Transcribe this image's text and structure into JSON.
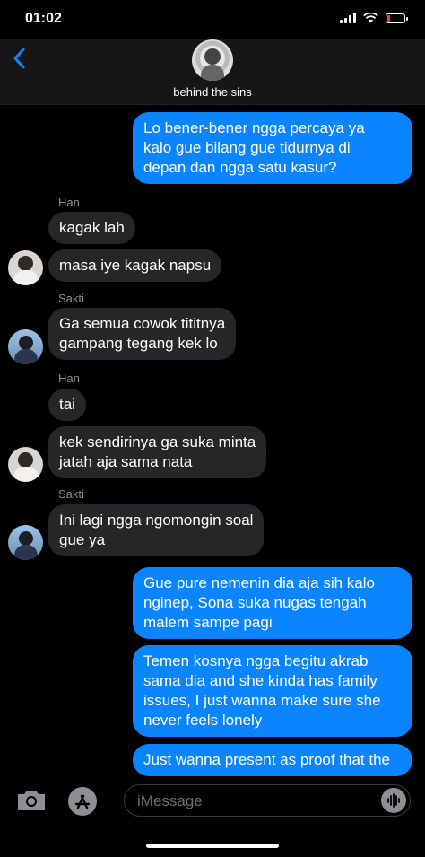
{
  "status": {
    "time": "01:02"
  },
  "header": {
    "contact_name": "behind the sins"
  },
  "messages": [
    {
      "text": "Lo bener-bener ngga percaya ya\nkalo gue bilang gue tidurnya di\ndepan dan ngga satu kasur?"
    },
    {
      "sender": "Han",
      "text": "kagak lah"
    },
    {
      "text": "masa iye kagak napsu"
    },
    {
      "sender": "Sakti",
      "text": "Ga semua cowok tititnya\ngampang tegang kek lo"
    },
    {
      "sender": "Han",
      "text": "tai"
    },
    {
      "text": "kek sendirinya ga suka minta\njatah aja sama nata"
    },
    {
      "sender": "Sakti",
      "text": "Ini lagi ngga ngomongin soal\ngue ya"
    },
    {
      "text": "Gue pure nemenin dia aja sih kalo\nnginep, Sona suka nugas tengah\nmalem sampe pagi"
    },
    {
      "text": "Temen kosnya ngga begitu akrab\nsama dia and she kinda has family\nissues, I just wanna make sure she\nnever feels lonely"
    },
    {
      "text": "Just wanna present as proof that the"
    }
  ],
  "input": {
    "placeholder": "iMessage"
  },
  "colors": {
    "outgoing": "#0a84ff",
    "incoming": "#262628",
    "accent": "#0a84ff",
    "battery_low": "#ff3b30"
  },
  "icons": [
    "back-chevron-icon",
    "camera-icon",
    "app-store-icon",
    "audio-waveform-icon",
    "wifi-icon",
    "signal-icon",
    "battery-icon"
  ],
  "battery_level": 0.2
}
